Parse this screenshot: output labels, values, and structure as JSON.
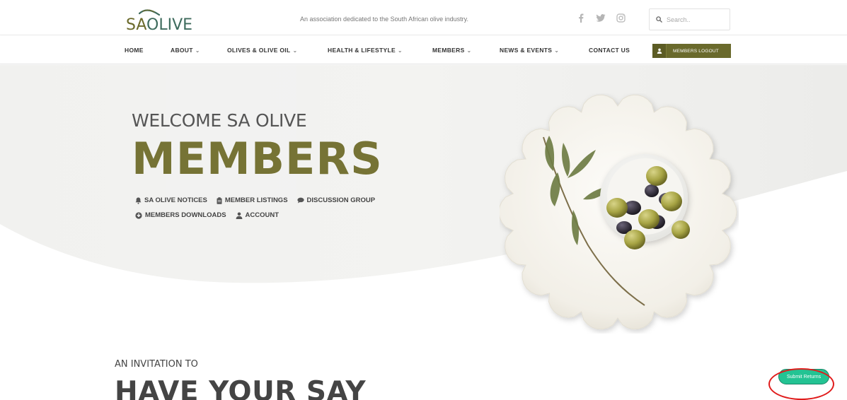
{
  "brand": {
    "logo_sa": "SA",
    "logo_olive": "OLIVE",
    "tagline": "An association dedicated to the South African olive industry.",
    "color_olive": "#6b6a2b",
    "color_green": "#3e6b5d"
  },
  "socials": [
    {
      "icon": "facebook-icon"
    },
    {
      "icon": "twitter-icon"
    },
    {
      "icon": "instagram-icon"
    }
  ],
  "search": {
    "placeholder": "Search..",
    "icon": "search-icon"
  },
  "nav": {
    "items": [
      {
        "label": "HOME",
        "has_dropdown": false
      },
      {
        "label": "ABOUT",
        "has_dropdown": true
      },
      {
        "label": "OLIVES & OLIVE OIL",
        "has_dropdown": true
      },
      {
        "label": "HEALTH & LIFESTYLE",
        "has_dropdown": true
      },
      {
        "label": "MEMBERS",
        "has_dropdown": true
      },
      {
        "label": "NEWS & EVENTS",
        "has_dropdown": true
      },
      {
        "label": "CONTACT US",
        "has_dropdown": false
      }
    ],
    "logout_label": "MEMBERS LOGOUT",
    "logout_icon": "user-icon"
  },
  "hero": {
    "welcome": "WELCOME SA OLIVE",
    "title": "MEMBERS",
    "links_row1": [
      {
        "label": "SA OLIVE NOTICES",
        "icon": "bell-icon"
      },
      {
        "label": "MEMBER LISTINGS",
        "icon": "clipboard-icon"
      },
      {
        "label": "DISCUSSION GROUP",
        "icon": "chat-icon"
      }
    ],
    "links_row2": [
      {
        "label": "MEMBERS DOWNLOADS",
        "icon": "download-icon"
      },
      {
        "label": "ACCOUNT",
        "icon": "user-icon"
      }
    ]
  },
  "invitation": {
    "kicker": "AN INVITATION TO",
    "heading": "HAVE YOUR SAY"
  },
  "submit": {
    "label": "Submit Returns",
    "color": "#23c393"
  },
  "colors": {
    "accent_olive": "#767335",
    "annotation_red": "#e01b1b"
  }
}
